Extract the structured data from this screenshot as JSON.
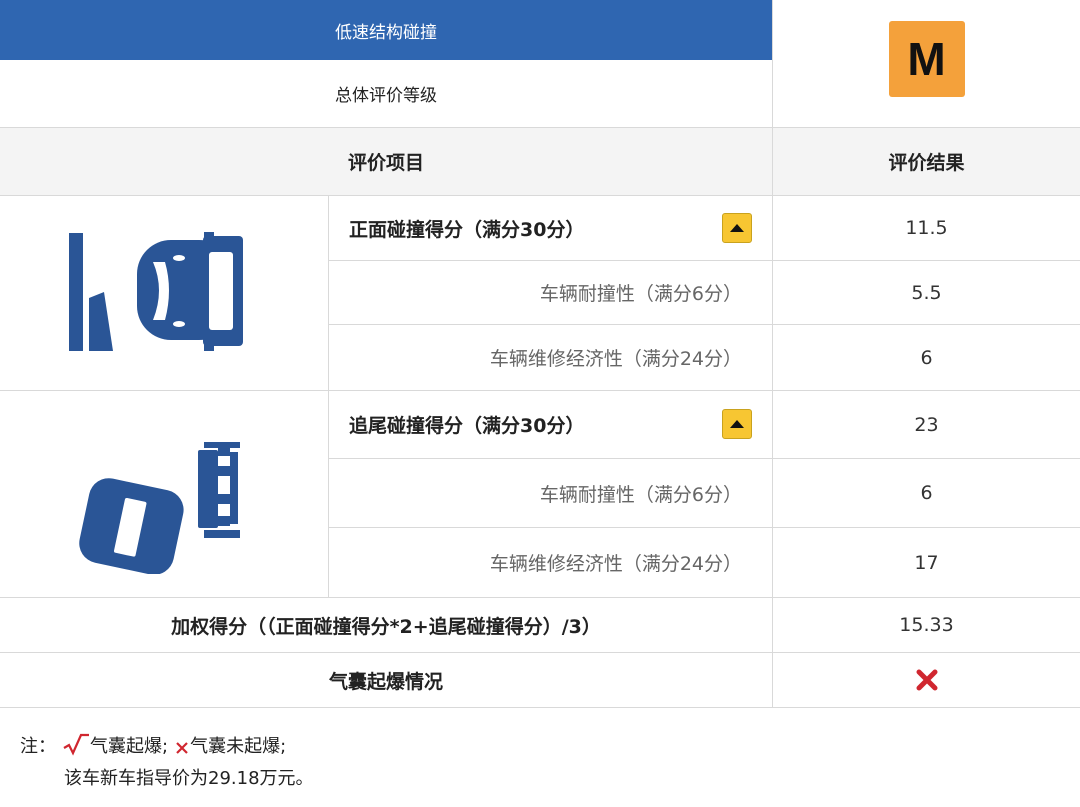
{
  "header": {
    "title": "低速结构碰撞",
    "overall_label": "总体评价等级",
    "overall_rating": "M",
    "colors": {
      "title_bg": "#2f66b1",
      "rating_bg": "#f4a13b",
      "toggle": "#f7c632",
      "icon": "#2a5596",
      "cross": "#d0262f"
    }
  },
  "columns": {
    "item": "评价项目",
    "result": "评价结果"
  },
  "front": {
    "icon": "front-crash-icon",
    "label": "正面碰撞得分（满分30分）",
    "score": "11.5",
    "subs": [
      {
        "label": "车辆耐撞性（满分6分）",
        "score": "5.5"
      },
      {
        "label": "车辆维修经济性（满分24分）",
        "score": "6"
      }
    ]
  },
  "rear": {
    "icon": "rear-crash-icon",
    "label": "追尾碰撞得分（满分30分）",
    "score": "23",
    "subs": [
      {
        "label": "车辆耐撞性（满分6分）",
        "score": "6"
      },
      {
        "label": "车辆维修经济性（满分24分）",
        "score": "17"
      }
    ]
  },
  "weighted": {
    "label": "加权得分（（正面碰撞得分*2+追尾碰撞得分）/3）",
    "score": "15.33"
  },
  "airbag": {
    "label": "气囊起爆情况",
    "result_icon": "cross-icon"
  },
  "notes": {
    "prefix": "注：",
    "deployed": "气囊起爆;",
    "not_deployed": "气囊未起爆;",
    "price": "该车新车指导价为29.18万元。"
  }
}
